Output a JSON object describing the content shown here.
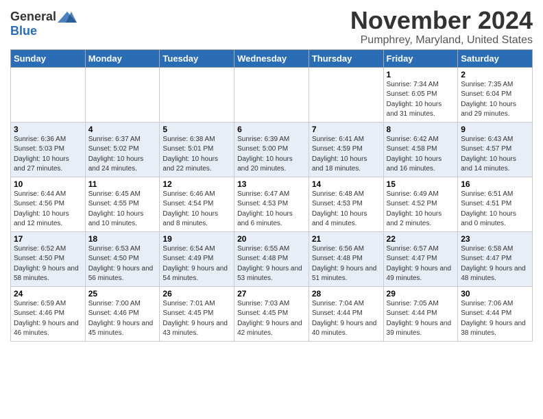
{
  "logo": {
    "general": "General",
    "blue": "Blue"
  },
  "title": "November 2024",
  "location": "Pumphrey, Maryland, United States",
  "headers": [
    "Sunday",
    "Monday",
    "Tuesday",
    "Wednesday",
    "Thursday",
    "Friday",
    "Saturday"
  ],
  "weeks": [
    [
      {
        "day": "",
        "sunrise": "",
        "sunset": "",
        "daylight": ""
      },
      {
        "day": "",
        "sunrise": "",
        "sunset": "",
        "daylight": ""
      },
      {
        "day": "",
        "sunrise": "",
        "sunset": "",
        "daylight": ""
      },
      {
        "day": "",
        "sunrise": "",
        "sunset": "",
        "daylight": ""
      },
      {
        "day": "",
        "sunrise": "",
        "sunset": "",
        "daylight": ""
      },
      {
        "day": "1",
        "sunrise": "Sunrise: 7:34 AM",
        "sunset": "Sunset: 6:05 PM",
        "daylight": "Daylight: 10 hours and 31 minutes."
      },
      {
        "day": "2",
        "sunrise": "Sunrise: 7:35 AM",
        "sunset": "Sunset: 6:04 PM",
        "daylight": "Daylight: 10 hours and 29 minutes."
      }
    ],
    [
      {
        "day": "3",
        "sunrise": "Sunrise: 6:36 AM",
        "sunset": "Sunset: 5:03 PM",
        "daylight": "Daylight: 10 hours and 27 minutes."
      },
      {
        "day": "4",
        "sunrise": "Sunrise: 6:37 AM",
        "sunset": "Sunset: 5:02 PM",
        "daylight": "Daylight: 10 hours and 24 minutes."
      },
      {
        "day": "5",
        "sunrise": "Sunrise: 6:38 AM",
        "sunset": "Sunset: 5:01 PM",
        "daylight": "Daylight: 10 hours and 22 minutes."
      },
      {
        "day": "6",
        "sunrise": "Sunrise: 6:39 AM",
        "sunset": "Sunset: 5:00 PM",
        "daylight": "Daylight: 10 hours and 20 minutes."
      },
      {
        "day": "7",
        "sunrise": "Sunrise: 6:41 AM",
        "sunset": "Sunset: 4:59 PM",
        "daylight": "Daylight: 10 hours and 18 minutes."
      },
      {
        "day": "8",
        "sunrise": "Sunrise: 6:42 AM",
        "sunset": "Sunset: 4:58 PM",
        "daylight": "Daylight: 10 hours and 16 minutes."
      },
      {
        "day": "9",
        "sunrise": "Sunrise: 6:43 AM",
        "sunset": "Sunset: 4:57 PM",
        "daylight": "Daylight: 10 hours and 14 minutes."
      }
    ],
    [
      {
        "day": "10",
        "sunrise": "Sunrise: 6:44 AM",
        "sunset": "Sunset: 4:56 PM",
        "daylight": "Daylight: 10 hours and 12 minutes."
      },
      {
        "day": "11",
        "sunrise": "Sunrise: 6:45 AM",
        "sunset": "Sunset: 4:55 PM",
        "daylight": "Daylight: 10 hours and 10 minutes."
      },
      {
        "day": "12",
        "sunrise": "Sunrise: 6:46 AM",
        "sunset": "Sunset: 4:54 PM",
        "daylight": "Daylight: 10 hours and 8 minutes."
      },
      {
        "day": "13",
        "sunrise": "Sunrise: 6:47 AM",
        "sunset": "Sunset: 4:53 PM",
        "daylight": "Daylight: 10 hours and 6 minutes."
      },
      {
        "day": "14",
        "sunrise": "Sunrise: 6:48 AM",
        "sunset": "Sunset: 4:53 PM",
        "daylight": "Daylight: 10 hours and 4 minutes."
      },
      {
        "day": "15",
        "sunrise": "Sunrise: 6:49 AM",
        "sunset": "Sunset: 4:52 PM",
        "daylight": "Daylight: 10 hours and 2 minutes."
      },
      {
        "day": "16",
        "sunrise": "Sunrise: 6:51 AM",
        "sunset": "Sunset: 4:51 PM",
        "daylight": "Daylight: 10 hours and 0 minutes."
      }
    ],
    [
      {
        "day": "17",
        "sunrise": "Sunrise: 6:52 AM",
        "sunset": "Sunset: 4:50 PM",
        "daylight": "Daylight: 9 hours and 58 minutes."
      },
      {
        "day": "18",
        "sunrise": "Sunrise: 6:53 AM",
        "sunset": "Sunset: 4:50 PM",
        "daylight": "Daylight: 9 hours and 56 minutes."
      },
      {
        "day": "19",
        "sunrise": "Sunrise: 6:54 AM",
        "sunset": "Sunset: 4:49 PM",
        "daylight": "Daylight: 9 hours and 54 minutes."
      },
      {
        "day": "20",
        "sunrise": "Sunrise: 6:55 AM",
        "sunset": "Sunset: 4:48 PM",
        "daylight": "Daylight: 9 hours and 53 minutes."
      },
      {
        "day": "21",
        "sunrise": "Sunrise: 6:56 AM",
        "sunset": "Sunset: 4:48 PM",
        "daylight": "Daylight: 9 hours and 51 minutes."
      },
      {
        "day": "22",
        "sunrise": "Sunrise: 6:57 AM",
        "sunset": "Sunset: 4:47 PM",
        "daylight": "Daylight: 9 hours and 49 minutes."
      },
      {
        "day": "23",
        "sunrise": "Sunrise: 6:58 AM",
        "sunset": "Sunset: 4:47 PM",
        "daylight": "Daylight: 9 hours and 48 minutes."
      }
    ],
    [
      {
        "day": "24",
        "sunrise": "Sunrise: 6:59 AM",
        "sunset": "Sunset: 4:46 PM",
        "daylight": "Daylight: 9 hours and 46 minutes."
      },
      {
        "day": "25",
        "sunrise": "Sunrise: 7:00 AM",
        "sunset": "Sunset: 4:46 PM",
        "daylight": "Daylight: 9 hours and 45 minutes."
      },
      {
        "day": "26",
        "sunrise": "Sunrise: 7:01 AM",
        "sunset": "Sunset: 4:45 PM",
        "daylight": "Daylight: 9 hours and 43 minutes."
      },
      {
        "day": "27",
        "sunrise": "Sunrise: 7:03 AM",
        "sunset": "Sunset: 4:45 PM",
        "daylight": "Daylight: 9 hours and 42 minutes."
      },
      {
        "day": "28",
        "sunrise": "Sunrise: 7:04 AM",
        "sunset": "Sunset: 4:44 PM",
        "daylight": "Daylight: 9 hours and 40 minutes."
      },
      {
        "day": "29",
        "sunrise": "Sunrise: 7:05 AM",
        "sunset": "Sunset: 4:44 PM",
        "daylight": "Daylight: 9 hours and 39 minutes."
      },
      {
        "day": "30",
        "sunrise": "Sunrise: 7:06 AM",
        "sunset": "Sunset: 4:44 PM",
        "daylight": "Daylight: 9 hours and 38 minutes."
      }
    ]
  ]
}
